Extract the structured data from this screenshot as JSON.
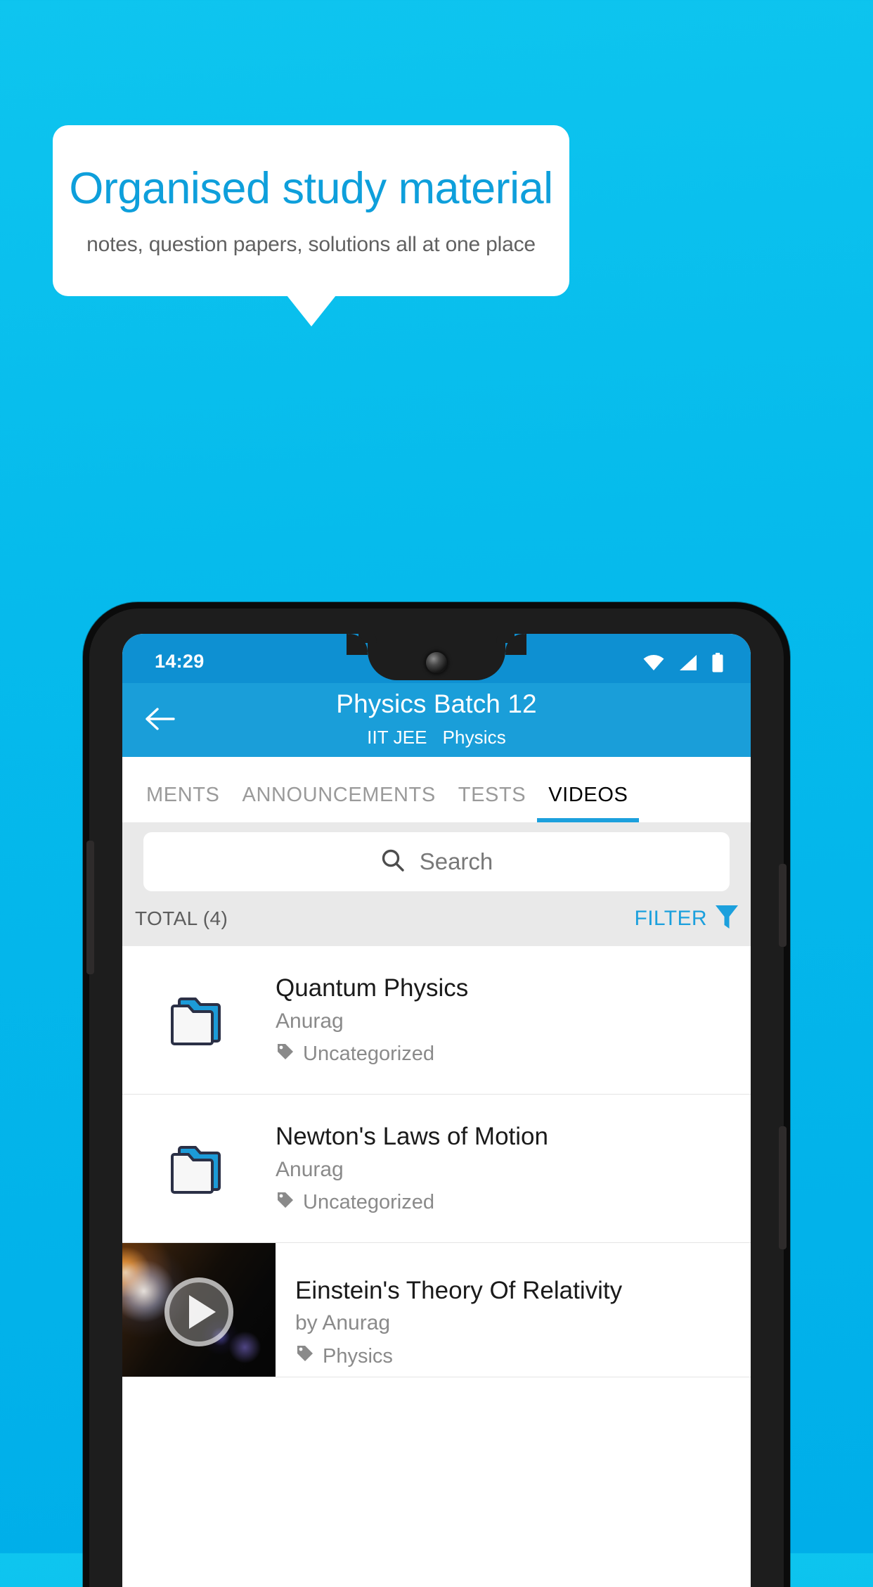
{
  "promo": {
    "title": "Organised study material",
    "subtitle": "notes, question papers, solutions all at one place"
  },
  "colors": {
    "background_top": "#0EC5EF",
    "background_bottom": "#00AEE9",
    "accent": "#1CA0DD",
    "appbar": "#1A9ED9",
    "statusbar": "#0E90D2",
    "promo_title": "#0E9FDB"
  },
  "phone": {
    "statusbar": {
      "time": "14:29",
      "icons": [
        "wifi-icon",
        "signal-icon",
        "battery-icon"
      ]
    },
    "appbar": {
      "back_icon": "back-arrow-icon",
      "title": "Physics Batch 12",
      "subtitle": "IIT JEE   Physics"
    },
    "tabs": [
      {
        "label": "MENTS",
        "active": false
      },
      {
        "label": "ANNOUNCEMENTS",
        "active": false
      },
      {
        "label": "TESTS",
        "active": false
      },
      {
        "label": "VIDEOS",
        "active": true
      }
    ],
    "search": {
      "icon": "search-icon",
      "placeholder": "Search",
      "value": ""
    },
    "toolbar": {
      "total_label": "TOTAL (4)",
      "filter_label": "FILTER",
      "filter_icon": "funnel-icon"
    },
    "list": [
      {
        "type": "folder",
        "icon": "folder-icon",
        "title": "Quantum Physics",
        "author": "Anurag",
        "tag_icon": "tag-icon",
        "tag": "Uncategorized"
      },
      {
        "type": "folder",
        "icon": "folder-icon",
        "title": "Newton's Laws of Motion",
        "author": "Anurag",
        "tag_icon": "tag-icon",
        "tag": "Uncategorized"
      },
      {
        "type": "video",
        "icon": "play-icon",
        "title": "Einstein's Theory Of Relativity",
        "author": "by Anurag",
        "tag_icon": "tag-icon",
        "tag": "Physics"
      }
    ]
  }
}
